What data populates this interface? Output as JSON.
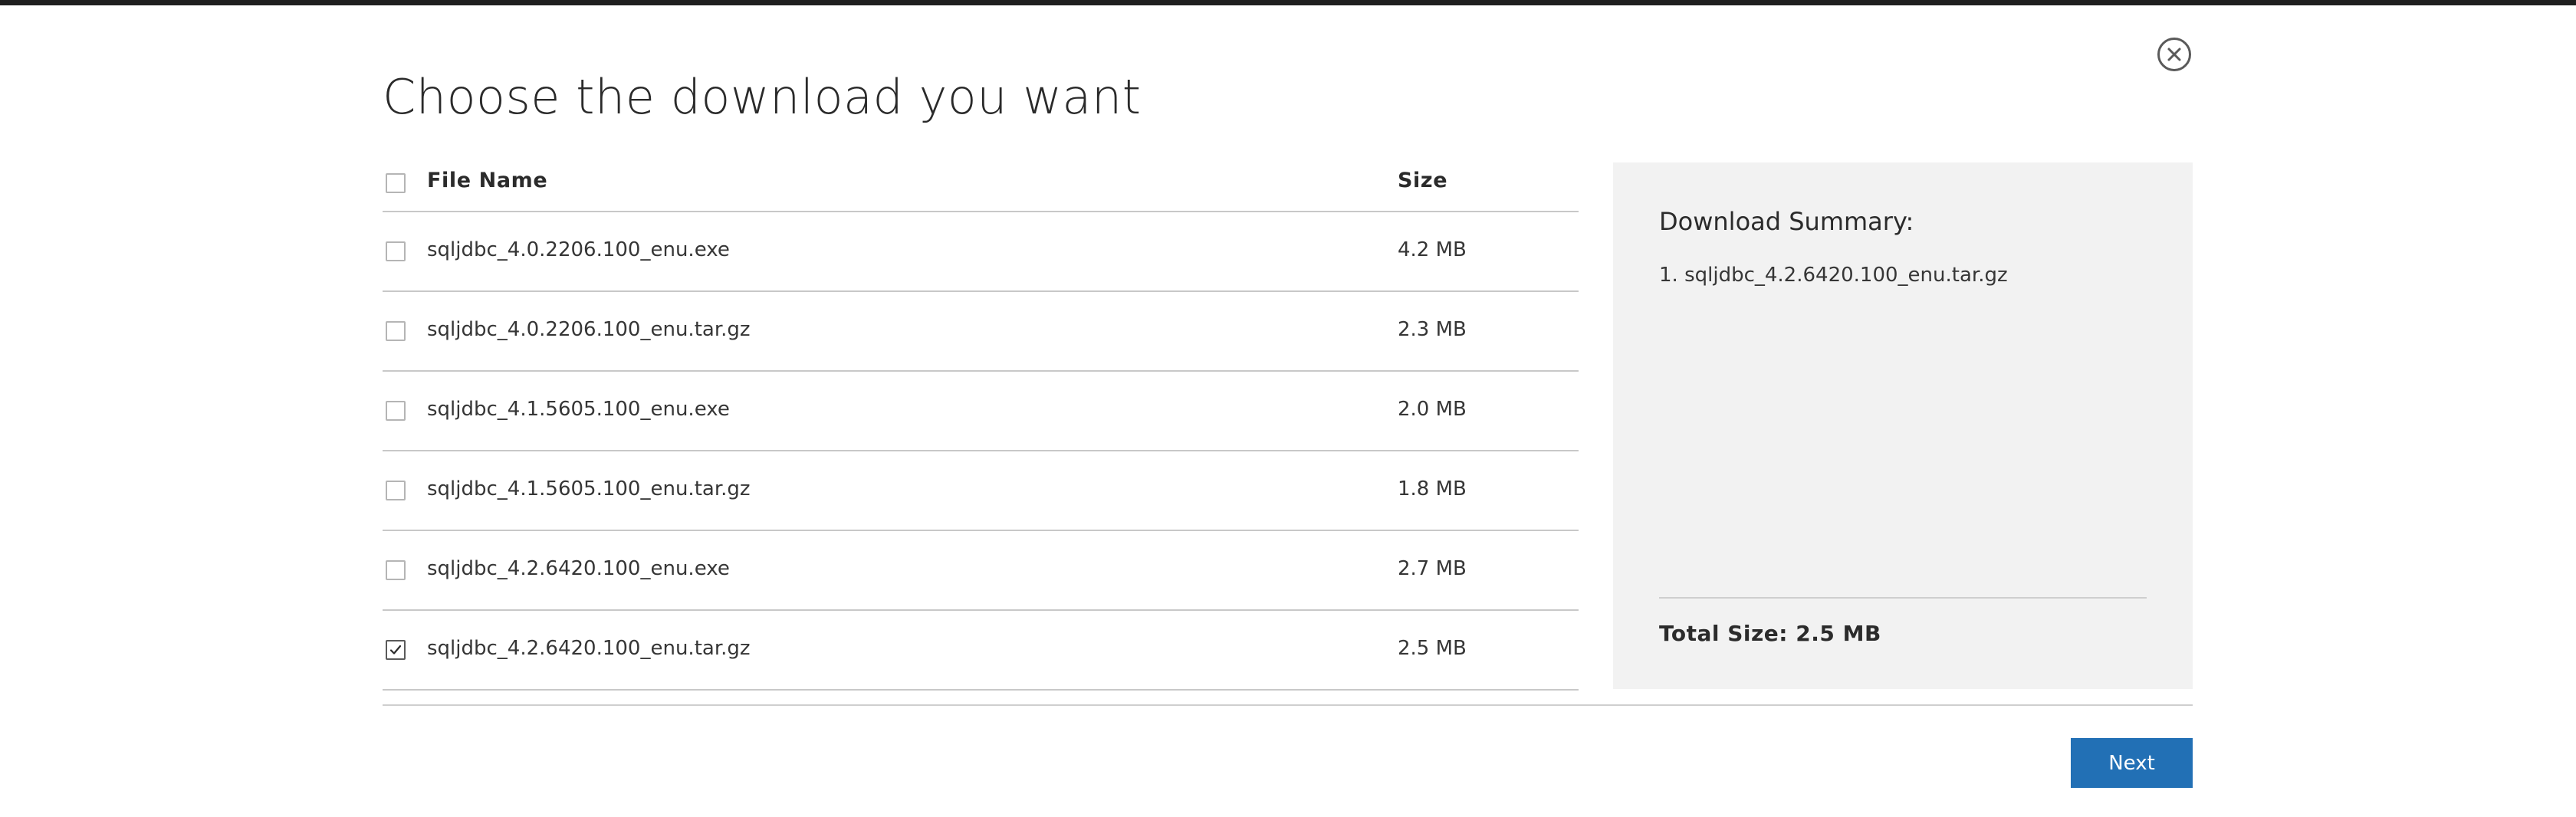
{
  "dialog": {
    "title": "Choose the download you want",
    "close_icon": "close-circle-icon"
  },
  "table": {
    "headers": {
      "name": "File Name",
      "size": "Size"
    },
    "select_all_checked": false,
    "rows": [
      {
        "name": "sqljdbc_4.0.2206.100_enu.exe",
        "size": "4.2 MB",
        "checked": false
      },
      {
        "name": "sqljdbc_4.0.2206.100_enu.tar.gz",
        "size": "2.3 MB",
        "checked": false
      },
      {
        "name": "sqljdbc_4.1.5605.100_enu.exe",
        "size": "2.0 MB",
        "checked": false
      },
      {
        "name": "sqljdbc_4.1.5605.100_enu.tar.gz",
        "size": "1.8 MB",
        "checked": false
      },
      {
        "name": "sqljdbc_4.2.6420.100_enu.exe",
        "size": "2.7 MB",
        "checked": false
      },
      {
        "name": "sqljdbc_4.2.6420.100_enu.tar.gz",
        "size": "2.5 MB",
        "checked": true
      }
    ]
  },
  "summary": {
    "title": "Download Summary:",
    "items": [
      "1. sqljdbc_4.2.6420.100_enu.tar.gz"
    ],
    "total": "Total Size: 2.5 MB"
  },
  "actions": {
    "next_label": "Next"
  },
  "colors": {
    "accent": "#2270b5",
    "panel_bg": "#f2f2f2",
    "top_bar": "#1f1f1f"
  }
}
